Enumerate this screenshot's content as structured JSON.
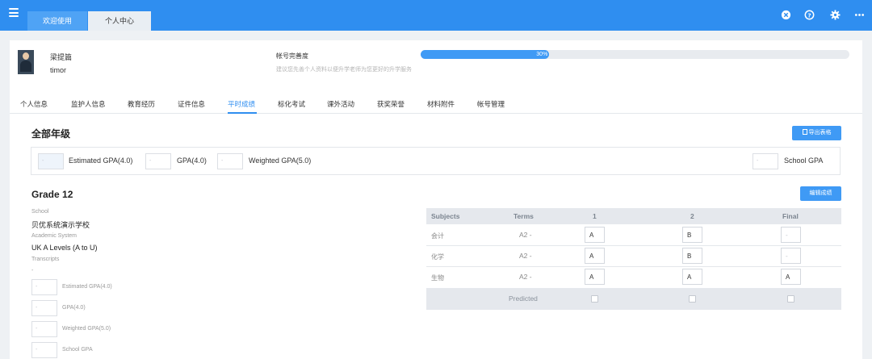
{
  "tabs": {
    "welcome": "欢迎使用",
    "profile": "个人中心"
  },
  "icons": {
    "menu": "hamburger-icon",
    "close": "close-circle-icon",
    "help": "help-circle-icon",
    "settings": "gear-icon",
    "more": "more-icon"
  },
  "colors": {
    "brand": "#2f8ef0",
    "accent": "#3f9af5"
  },
  "user": {
    "name": "梁提篇",
    "username": "timor"
  },
  "profile_progress": {
    "label": "帐号完善度",
    "value_text": "30%",
    "percent": 30,
    "hint": "建议您先善个人资料以便升学老师为您更好的升学服务"
  },
  "nav": {
    "items": [
      "个人信息",
      "监护人信息",
      "教育经历",
      "证件信息",
      "平时成绩",
      "标化考试",
      "课外活动",
      "获奖荣誉",
      "材料附件",
      "帐号管理"
    ],
    "active": "平时成绩"
  },
  "all_grades": {
    "title": "全部年级",
    "export_label": "导出表格",
    "fields": [
      {
        "label": "Estimated GPA(4.0)",
        "value": "-"
      },
      {
        "label": "GPA(4.0)",
        "value": "-"
      },
      {
        "label": "Weighted GPA(5.0)",
        "value": "-"
      },
      {
        "label": "School GPA",
        "value": "-"
      }
    ]
  },
  "grade12": {
    "title": "Grade 12",
    "edit_label": "编辑成绩",
    "school_label": "School",
    "school_value": "贝优系统演示学校",
    "system_label": "Academic System",
    "system_value": "UK A Levels (A to U)",
    "transcripts_label": "Transcripts",
    "transcripts_value": "-",
    "side_fields": [
      {
        "label": "Estimated GPA(4.0)",
        "value": "-"
      },
      {
        "label": "GPA(4.0)",
        "value": "-"
      },
      {
        "label": "Weighted GPA(5.0)",
        "value": "-"
      },
      {
        "label": "School GPA",
        "value": "-"
      }
    ],
    "table": {
      "headers": [
        "Subjects",
        "Terms",
        "1",
        "2",
        "Final"
      ],
      "rows": [
        {
          "subject": "会计",
          "term": "A2 -",
          "t1": "A",
          "t2": "B",
          "final": "-"
        },
        {
          "subject": "化学",
          "term": "A2 -",
          "t1": "A",
          "t2": "B",
          "final": "-"
        },
        {
          "subject": "生物",
          "term": "A2 -",
          "t1": "A",
          "t2": "A",
          "final": "A"
        }
      ],
      "predicted_label": "Predicted"
    }
  }
}
